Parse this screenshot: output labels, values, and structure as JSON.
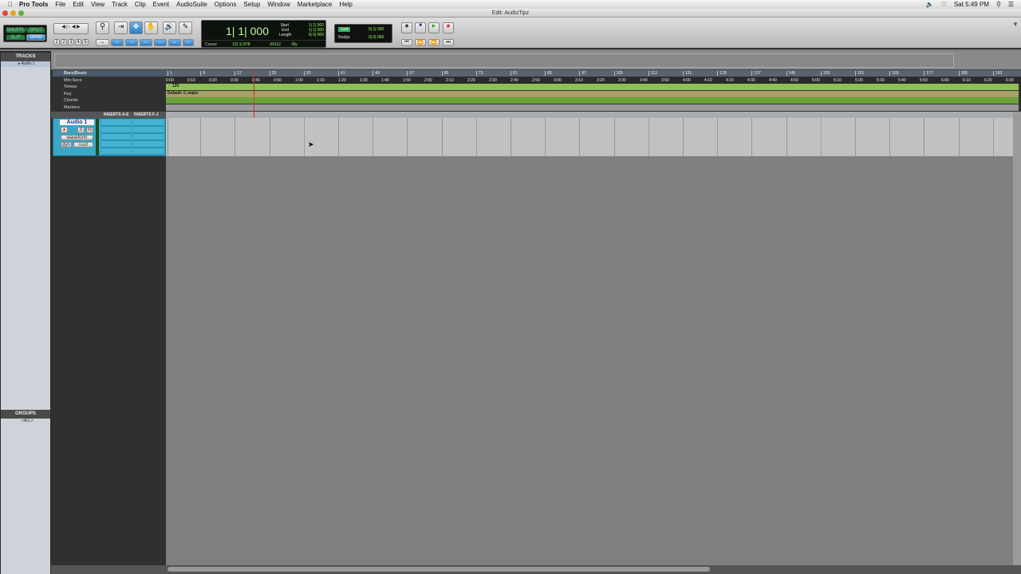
{
  "menubar": {
    "app": "Pro Tools",
    "items": [
      "File",
      "Edit",
      "View",
      "Track",
      "Clip",
      "Event",
      "AudioSuite",
      "Options",
      "Setup",
      "Window",
      "Marketplace",
      "Help"
    ],
    "clock": "Sat 5:49 PM"
  },
  "window": {
    "title": "Edit: AudioTipz"
  },
  "modes": {
    "shuffle": "SHUFFLE",
    "spot": "SPOT",
    "slip": "SLIP",
    "grid": "GRID"
  },
  "zoom_presets": [
    "1",
    "2",
    "3",
    "4",
    "5"
  ],
  "counter": {
    "main": "1| 1| 000",
    "start_label": "Start",
    "end_label": "End",
    "length_label": "Length",
    "start": "1| 1| 000",
    "end": "1| 1| 000",
    "length": "0| 0| 000",
    "cursor_label": "Cursor",
    "cursor": "22| 1| 878",
    "offset": "-26112",
    "dly": "Dly"
  },
  "grid": {
    "grid_label": "Grid",
    "grid_value": "0| 1| 000",
    "nudge_label": "Nudge",
    "nudge_value": "0| 0| 060"
  },
  "tracks_panel": {
    "title": "TRACKS",
    "items": [
      "Audio 1"
    ]
  },
  "groups_panel": {
    "title": "GROUPS",
    "items": [
      "<ALL>"
    ]
  },
  "rulers": {
    "bars_label": "Bars|Beats",
    "min_label": "Min:Secs",
    "tempo_label": "Tempo",
    "key_label": "Key",
    "chords_label": "Chords",
    "markers_label": "Markers",
    "tempo_value": "120",
    "key_value": "Default: C major",
    "bars": [
      "1",
      "9",
      "17",
      "25",
      "33",
      "41",
      "49",
      "57",
      "65",
      "73",
      "81",
      "89",
      "97",
      "105",
      "113",
      "121",
      "129",
      "137",
      "145",
      "153",
      "161",
      "169",
      "177",
      "185",
      "193"
    ],
    "minsecs": [
      "0:00",
      "0:10",
      "0:20",
      "0:30",
      "0:40",
      "0:50",
      "1:00",
      "1:10",
      "1:20",
      "1:30",
      "1:40",
      "1:50",
      "2:00",
      "2:10",
      "2:20",
      "2:30",
      "2:40",
      "2:50",
      "3:00",
      "3:10",
      "3:20",
      "3:30",
      "3:40",
      "3:50",
      "4:00",
      "4:10",
      "4:20",
      "4:30",
      "4:40",
      "4:50",
      "5:00",
      "5:10",
      "5:20",
      "5:30",
      "5:40",
      "5:50",
      "6:00",
      "6:10",
      "6:20",
      "6:30"
    ]
  },
  "columns": {
    "inserts_ae": "INSERTS A-E",
    "inserts_fj": "INSERTS F-J"
  },
  "track": {
    "name": "Audio 1",
    "solo": "S",
    "mute": "M",
    "view": "waveform",
    "dyn": "dyn",
    "automation": "read"
  },
  "colors": {
    "track": "#3aa7c6",
    "tempo": "#8fbf5a",
    "key": "#a89f6a",
    "chords": "#6aa33a",
    "playhead": "#d0303a"
  }
}
